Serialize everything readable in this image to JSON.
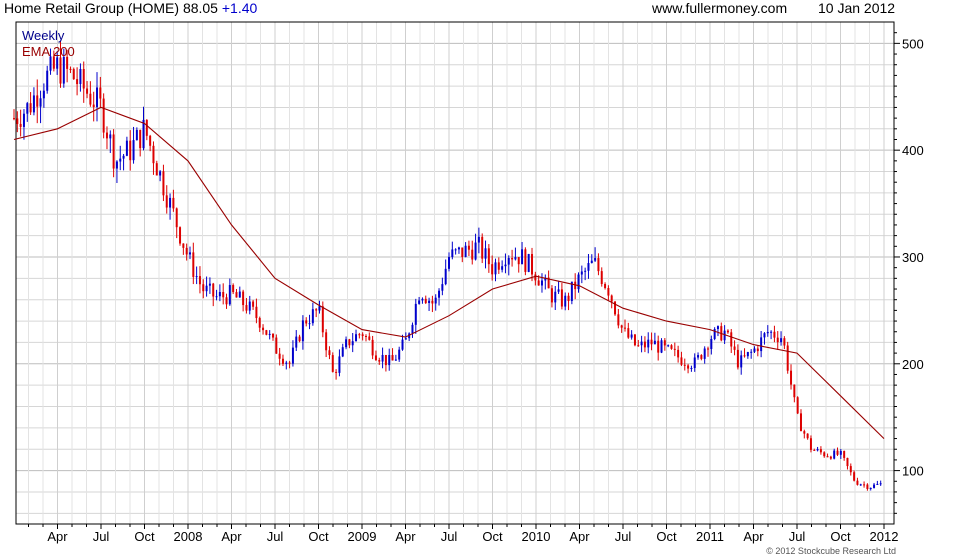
{
  "header": {
    "name": "Home Retail Group (HOME)",
    "price": "88.05",
    "change": "+1.40",
    "site": "www.fullermoney.com",
    "date": "10 Jan 2012"
  },
  "legend": {
    "weekly": "Weekly",
    "ema": "EMA 200"
  },
  "copyright": "© 2012 Stockcube Research Ltd",
  "colors": {
    "up": "#0000cc",
    "down": "#dd0000",
    "ema": "#990000",
    "grid": "#d6d6d6",
    "legend_weekly": "#00008b"
  },
  "chart_data": {
    "type": "candlestick",
    "x_scale": "time (weekly, Jan 2007 – Jan 2012)",
    "ylim": [
      50,
      520
    ],
    "y_ticks": [
      100,
      200,
      300,
      400,
      500
    ],
    "x_tick_labels": [
      "Apr",
      "Jul",
      "Oct",
      "2008",
      "Apr",
      "Jul",
      "Oct",
      "2009",
      "Apr",
      "Jul",
      "Oct",
      "2010",
      "Apr",
      "Jul",
      "Oct",
      "2011",
      "Apr",
      "Jul",
      "Oct",
      "2012"
    ],
    "grid": true,
    "legend_position": "top-left",
    "close_series": {
      "name": "Weekly",
      "x": [
        "2007-01",
        "2007-02",
        "2007-03",
        "2007-04",
        "2007-05",
        "2007-06",
        "2007-07",
        "2007-08",
        "2007-09",
        "2007-10",
        "2007-11",
        "2007-12",
        "2008-01",
        "2008-02",
        "2008-03",
        "2008-04",
        "2008-05",
        "2008-06",
        "2008-07",
        "2008-08",
        "2008-09",
        "2008-10",
        "2008-11",
        "2008-12",
        "2009-01",
        "2009-02",
        "2009-03",
        "2009-04",
        "2009-05",
        "2009-06",
        "2009-07",
        "2009-08",
        "2009-09",
        "2009-10",
        "2009-11",
        "2009-12",
        "2010-01",
        "2010-02",
        "2010-03",
        "2010-04",
        "2010-05",
        "2010-06",
        "2010-07",
        "2010-08",
        "2010-09",
        "2010-10",
        "2010-11",
        "2010-12",
        "2011-01",
        "2011-02",
        "2011-03",
        "2011-04",
        "2011-05",
        "2011-06",
        "2011-07",
        "2011-08",
        "2011-09",
        "2011-10",
        "2011-11",
        "2011-12",
        "2012-01"
      ],
      "values": [
        430,
        440,
        465,
        478,
        470,
        455,
        440,
        390,
        400,
        420,
        380,
        340,
        300,
        270,
        262,
        265,
        255,
        240,
        215,
        200,
        240,
        250,
        190,
        220,
        230,
        210,
        200,
        220,
        270,
        255,
        300,
        305,
        310,
        290,
        305,
        300,
        285,
        265,
        258,
        280,
        295,
        270,
        230,
        215,
        220,
        212,
        205,
        200,
        225,
        230,
        200,
        212,
        230,
        225,
        150,
        120,
        115,
        115,
        90,
        85,
        88
      ]
    },
    "ema_series": {
      "name": "EMA 200",
      "x": [
        "2007-01",
        "2007-04",
        "2007-07",
        "2007-10",
        "2008-01",
        "2008-04",
        "2008-07",
        "2008-10",
        "2009-01",
        "2009-04",
        "2009-07",
        "2009-10",
        "2010-01",
        "2010-04",
        "2010-07",
        "2010-10",
        "2011-01",
        "2011-04",
        "2011-07",
        "2011-10",
        "2012-01"
      ],
      "values": [
        410,
        420,
        440,
        425,
        390,
        330,
        280,
        255,
        232,
        225,
        245,
        270,
        282,
        273,
        252,
        240,
        232,
        218,
        210,
        170,
        130
      ]
    }
  }
}
